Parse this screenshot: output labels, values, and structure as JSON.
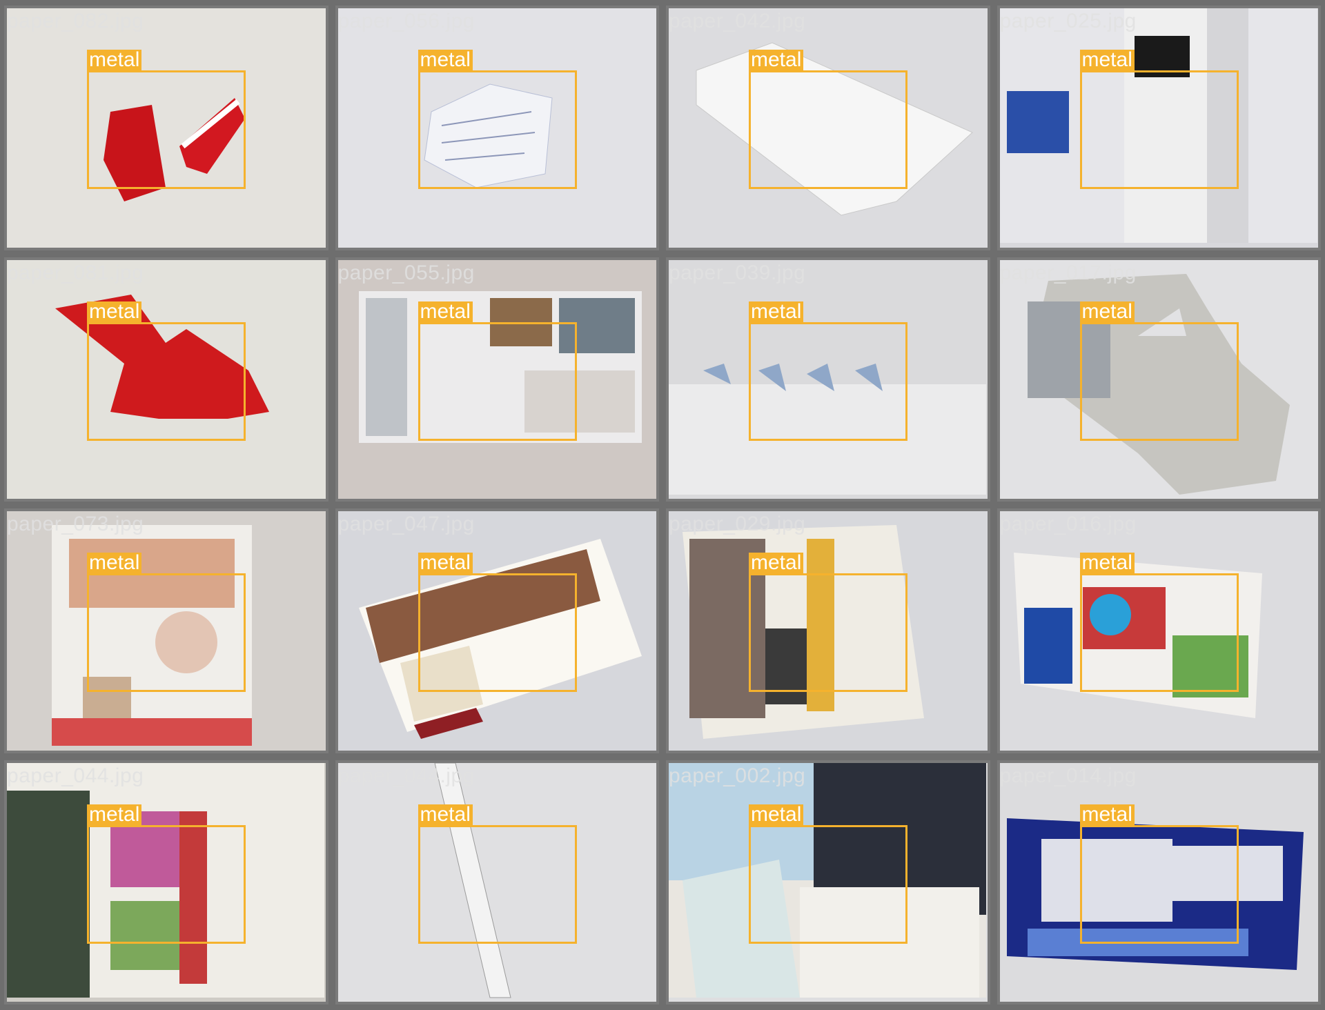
{
  "grid": {
    "tiles": [
      {
        "filename": "paper_082.jpg",
        "label": "metal",
        "bg": "#e4e2dd",
        "obj": "red-wrapper"
      },
      {
        "filename": "paper_056.jpg",
        "label": "metal",
        "bg": "#e2e2e6",
        "obj": "crumpled-note"
      },
      {
        "filename": "paper_042.jpg",
        "label": "metal",
        "bg": "#dcdcdf",
        "obj": "white-envelope"
      },
      {
        "filename": "paper_025.jpg",
        "label": "metal",
        "bg": "#d8d8dc",
        "obj": "coupon-flyer"
      },
      {
        "filename": "paper_081.jpg",
        "label": "metal",
        "bg": "#e3e2dc",
        "obj": "red-wrapper-2"
      },
      {
        "filename": "paper_055.jpg",
        "label": "metal",
        "bg": "#cfc8c4",
        "obj": "ad-catalog"
      },
      {
        "filename": "paper_039.jpg",
        "label": "metal",
        "bg": "#dadadc",
        "obj": "perforated-strip"
      },
      {
        "filename": "paper_017.jpg",
        "label": "metal",
        "bg": "#e2e2e4",
        "obj": "cardboard"
      },
      {
        "filename": "paper_073.jpg",
        "label": "metal",
        "bg": "#d4d0cc",
        "obj": "toy-flyer"
      },
      {
        "filename": "paper_047.jpg",
        "label": "metal",
        "bg": "#d6d7dc",
        "obj": "wine-postcard"
      },
      {
        "filename": "paper_029.jpg",
        "label": "metal",
        "bg": "#d7d8dc",
        "obj": "news-ad"
      },
      {
        "filename": "paper_016.jpg",
        "label": "metal",
        "bg": "#dcdcdf",
        "obj": "rite-aid-flyer"
      },
      {
        "filename": "paper_044.jpg",
        "label": "metal",
        "bg": "#cfccc6",
        "obj": "garden-flyer"
      },
      {
        "filename": "paper_044.jpg",
        "label": "metal",
        "bg": "#e0e0e2",
        "obj": "strip"
      },
      {
        "filename": "paper_002.jpg",
        "label": "metal",
        "bg": "#dedee0",
        "obj": "magazine"
      },
      {
        "filename": "paper_014.jpg",
        "label": "metal",
        "bg": "#dcdcde",
        "obj": "bbb-coupon"
      }
    ]
  },
  "colors": {
    "box": "#f5b22d",
    "label_text": "#ffffff",
    "frame": "#7a7a7a"
  }
}
